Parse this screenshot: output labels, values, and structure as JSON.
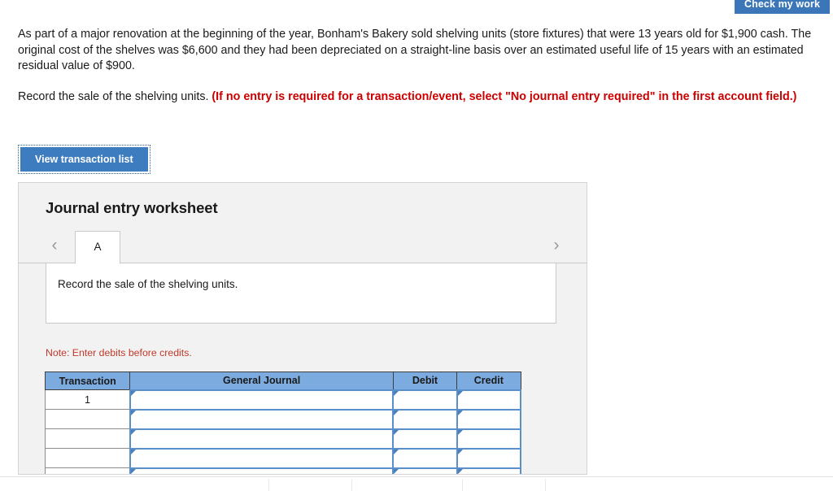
{
  "header": {
    "check_my_work_label": "Check my work"
  },
  "problem": {
    "statement": "As part of a major renovation at the beginning of the year, Bonham's Bakery sold shelving units (store fixtures) that were 13 years old for $1,900 cash. The original cost of the shelves was $6,600 and they had been depreciated on a straight-line basis over an estimated useful life of 15 years with an estimated residual value of $900.",
    "requirement_plain": "Record the sale of the shelving units. ",
    "requirement_note": "(If no entry is required for a transaction/event, select \"No journal entry required\" in the first account field.)"
  },
  "actions": {
    "view_transaction_list_label": "View transaction list"
  },
  "worksheet": {
    "title": "Journal entry worksheet",
    "prev_arrow": "‹",
    "next_arrow": "›",
    "tabs": [
      {
        "label": "A",
        "active": true
      }
    ],
    "description": "Record the sale of the shelving units.",
    "note": "Note: Enter debits before credits.",
    "table": {
      "columns": [
        "Transaction",
        "General Journal",
        "Debit",
        "Credit"
      ],
      "rows": [
        {
          "transaction": "1",
          "general_journal": "",
          "debit": "",
          "credit": ""
        },
        {
          "transaction": "",
          "general_journal": "",
          "debit": "",
          "credit": ""
        },
        {
          "transaction": "",
          "general_journal": "",
          "debit": "",
          "credit": ""
        },
        {
          "transaction": "",
          "general_journal": "",
          "debit": "",
          "credit": ""
        },
        {
          "transaction": "",
          "general_journal": "",
          "debit": "",
          "credit": ""
        }
      ]
    }
  },
  "colors": {
    "button_blue": "#3d7cbe",
    "check_work_blue": "#3b76b8",
    "table_header_blue": "#7cabe0",
    "input_border_blue": "#5b8fc9",
    "note_red": "#c0392b",
    "requirement_red": "#cc0000",
    "panel_gray": "#f2f2f2"
  }
}
